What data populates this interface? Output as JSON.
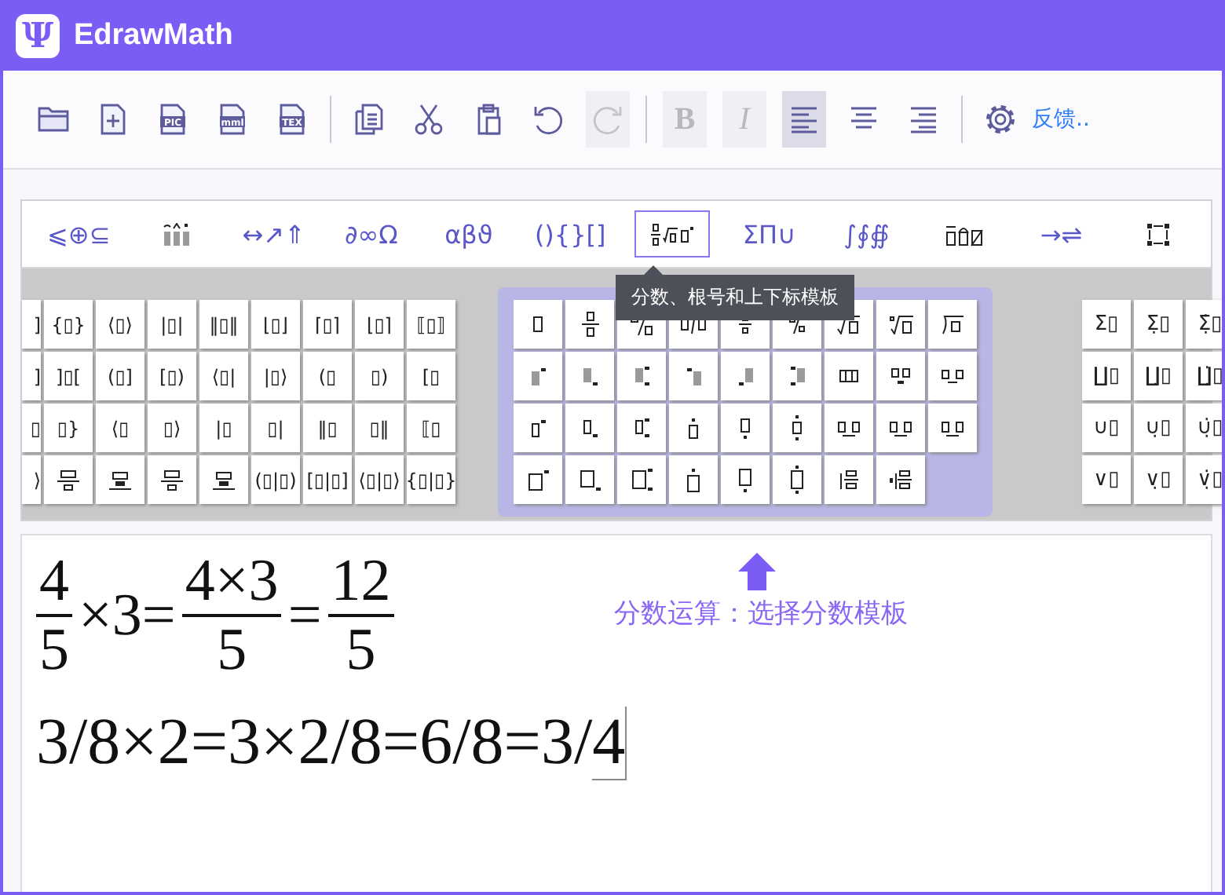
{
  "window": {
    "logo": "Ψ",
    "title": "EdrawMath"
  },
  "toolbar": [
    {
      "kind": "open"
    },
    {
      "kind": "new"
    },
    {
      "kind": "file-label",
      "label": "PIC"
    },
    {
      "kind": "file-label",
      "label": "mml"
    },
    {
      "kind": "file-label",
      "label": "TEX"
    },
    {
      "kind": "separator"
    },
    {
      "kind": "copy"
    },
    {
      "kind": "cut"
    },
    {
      "kind": "paste"
    },
    {
      "kind": "undo",
      "disabled": false
    },
    {
      "kind": "redo",
      "disabled": true
    },
    {
      "kind": "separator"
    },
    {
      "kind": "bold",
      "label": "B",
      "disabled": true
    },
    {
      "kind": "italic",
      "label": "I",
      "disabled": true
    },
    {
      "kind": "align-left",
      "selected": true
    },
    {
      "kind": "align-center",
      "selected": false
    },
    {
      "kind": "align-right",
      "selected": false
    },
    {
      "kind": "separator"
    },
    {
      "kind": "settings"
    },
    {
      "kind": "link",
      "label": "反馈.."
    }
  ],
  "palette_tabs": [
    {
      "kind": "text",
      "label": "⩽⊕⊆",
      "selected": false
    },
    {
      "kind": "accents",
      "selected": false
    },
    {
      "kind": "text",
      "label": "↔↗⇑",
      "selected": false
    },
    {
      "kind": "text",
      "label": "∂∞Ω",
      "selected": false
    },
    {
      "kind": "text",
      "label": "αβϑ",
      "selected": false
    },
    {
      "kind": "text",
      "label": "(){}[]",
      "selected": false
    },
    {
      "kind": "fractions",
      "selected": true
    },
    {
      "kind": "text",
      "label": "ΣΠ∪",
      "selected": false
    },
    {
      "kind": "text",
      "label": "∫∮∯",
      "selected": false
    },
    {
      "kind": "boxes",
      "selected": false
    },
    {
      "kind": "text",
      "label": "→⇌",
      "selected": false
    },
    {
      "kind": "matrix",
      "selected": false
    }
  ],
  "tooltip": "分数、根号和上下标模板",
  "bracket_templates": [
    [
      {
        "kind": "text",
        "label": "]"
      },
      {
        "kind": "text",
        "label": "{▯}"
      },
      {
        "kind": "text",
        "label": "⟨▯⟩"
      },
      {
        "kind": "text",
        "label": "|▯|"
      },
      {
        "kind": "text",
        "label": "‖▯‖"
      },
      {
        "kind": "text",
        "label": "⌊▯⌋"
      },
      {
        "kind": "text",
        "label": "⌈▯⌉"
      },
      {
        "kind": "text",
        "label": "⌊▯⌉"
      },
      {
        "kind": "text",
        "label": "⟦▯⟧"
      }
    ],
    [
      {
        "kind": "text",
        "label": "]"
      },
      {
        "kind": "text",
        "label": "]▯["
      },
      {
        "kind": "text",
        "label": "(▯]"
      },
      {
        "kind": "text",
        "label": "[▯)"
      },
      {
        "kind": "text",
        "label": "⟨▯|"
      },
      {
        "kind": "text",
        "label": "|▯⟩"
      },
      {
        "kind": "text",
        "label": "(▯"
      },
      {
        "kind": "text",
        "label": "▯)"
      },
      {
        "kind": "text",
        "label": "[▯"
      }
    ],
    [
      {
        "kind": "text",
        "label": "▯"
      },
      {
        "kind": "text",
        "label": "▯}"
      },
      {
        "kind": "text",
        "label": "⟨▯"
      },
      {
        "kind": "text",
        "label": "▯⟩"
      },
      {
        "kind": "text",
        "label": "|▯"
      },
      {
        "kind": "text",
        "label": "▯|"
      },
      {
        "kind": "text",
        "label": "‖▯"
      },
      {
        "kind": "text",
        "label": "▯‖"
      },
      {
        "kind": "text",
        "label": "⟦▯"
      }
    ],
    [
      {
        "kind": "text",
        "label": "⟩"
      },
      {
        "kind": "over-bar"
      },
      {
        "kind": "under-bar"
      },
      {
        "kind": "over-bar"
      },
      {
        "kind": "under-bar"
      },
      {
        "kind": "text",
        "label": "(▯|▯)"
      },
      {
        "kind": "text",
        "label": "[▯|▯]"
      },
      {
        "kind": "text",
        "label": "⟨▯|▯⟩"
      },
      {
        "kind": "text",
        "label": "{▯|▯}"
      }
    ]
  ],
  "fraction_templates": [
    [
      {
        "kind": "box"
      },
      {
        "kind": "fraction"
      },
      {
        "kind": "slash-fraction"
      },
      {
        "kind": "inline-fraction"
      },
      {
        "kind": "small-fraction"
      },
      {
        "kind": "small-slash"
      },
      {
        "kind": "root"
      },
      {
        "kind": "nth-root"
      },
      {
        "kind": "long-division"
      }
    ],
    [
      {
        "kind": "sup-shaded"
      },
      {
        "kind": "sub-shaded"
      },
      {
        "kind": "subsup-shaded"
      },
      {
        "kind": "presup-shaded"
      },
      {
        "kind": "presub-shaded"
      },
      {
        "kind": "presubsup-shaded"
      },
      {
        "kind": "triple-box"
      },
      {
        "kind": "below-pair"
      },
      {
        "kind": "below-pair-wide"
      }
    ],
    [
      {
        "kind": "sup"
      },
      {
        "kind": "sub"
      },
      {
        "kind": "subsup"
      },
      {
        "kind": "over"
      },
      {
        "kind": "under"
      },
      {
        "kind": "overunder"
      },
      {
        "kind": "joined-pair"
      },
      {
        "kind": "joined-pair"
      },
      {
        "kind": "joined-pair"
      }
    ],
    [
      {
        "kind": "big-sup"
      },
      {
        "kind": "big-sub"
      },
      {
        "kind": "big-subsup"
      },
      {
        "kind": "big-over"
      },
      {
        "kind": "big-under"
      },
      {
        "kind": "big-overunder"
      },
      {
        "kind": "stack"
      },
      {
        "kind": "left-stack"
      }
    ]
  ],
  "sum_templates": [
    [
      "Σ▯",
      "Σ̣▯",
      "Σ̣̇▯"
    ],
    [
      "∐▯",
      "∐̣▯",
      "∐̣̇▯"
    ],
    [
      "∪▯",
      "∪̣▯",
      "∪̣̇▯"
    ],
    [
      "∨▯",
      "∨̣▯",
      "∨̣̇▯"
    ]
  ],
  "editor": {
    "line_1": [
      {
        "kind": "fraction",
        "num": "4",
        "den": "5"
      },
      {
        "kind": "text",
        "text": "×3="
      },
      {
        "kind": "fraction",
        "num": "4×3",
        "den": "5"
      },
      {
        "kind": "text",
        "text": "="
      },
      {
        "kind": "fraction",
        "num": "12",
        "den": "5"
      }
    ],
    "line_2": [
      {
        "text": "3/8×2=3×2/8=6/8=3/",
        "cursor": false
      },
      {
        "text": "4",
        "cursor": true
      }
    ],
    "note": "分数运算：选择分数模板"
  }
}
